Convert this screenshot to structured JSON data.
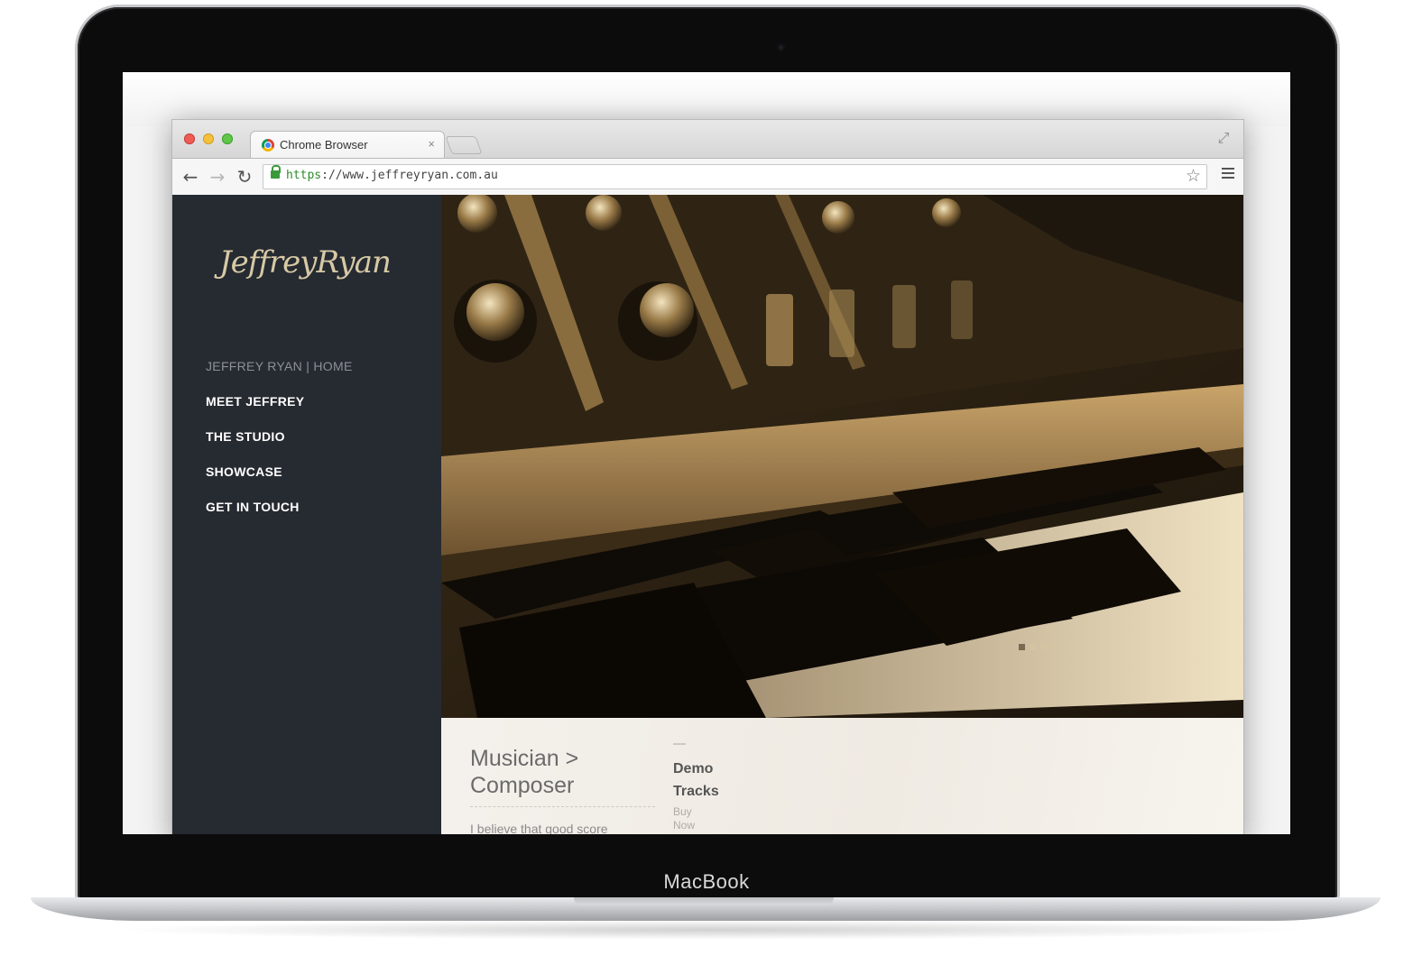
{
  "device": {
    "label": "MacBook"
  },
  "browser": {
    "tab_title": "Chrome Browser",
    "tab_close": "×",
    "url_scheme": "https",
    "url_rest": "://www.jeffreyryan.com.au"
  },
  "site": {
    "logo_text": "JeffreyRyan",
    "nav": [
      {
        "label": "JEFFREY RYAN  |  HOME",
        "current": true
      },
      {
        "label": "MEET JEFFREY"
      },
      {
        "label": "THE STUDIO"
      },
      {
        "label": "SHOWCASE"
      },
      {
        "label": "GET IN TOUCH"
      }
    ],
    "hero": {
      "slides": 3,
      "active_slide": 1,
      "image_subject": "synthesizer keyboard close-up (sepia)"
    },
    "tagline_line1": "Musician >",
    "tagline_line2": "Composer",
    "intro": "I believe that good score",
    "tracks_line1": "Demo",
    "tracks_line2": "Tracks",
    "buy_line1": "Buy",
    "buy_line2": "Now"
  },
  "colors": {
    "sidebar_bg": "#262a31",
    "logo": "#d6c9a5",
    "accent_sepia": "#b9924c",
    "content_bg": "#f4f1ec"
  }
}
